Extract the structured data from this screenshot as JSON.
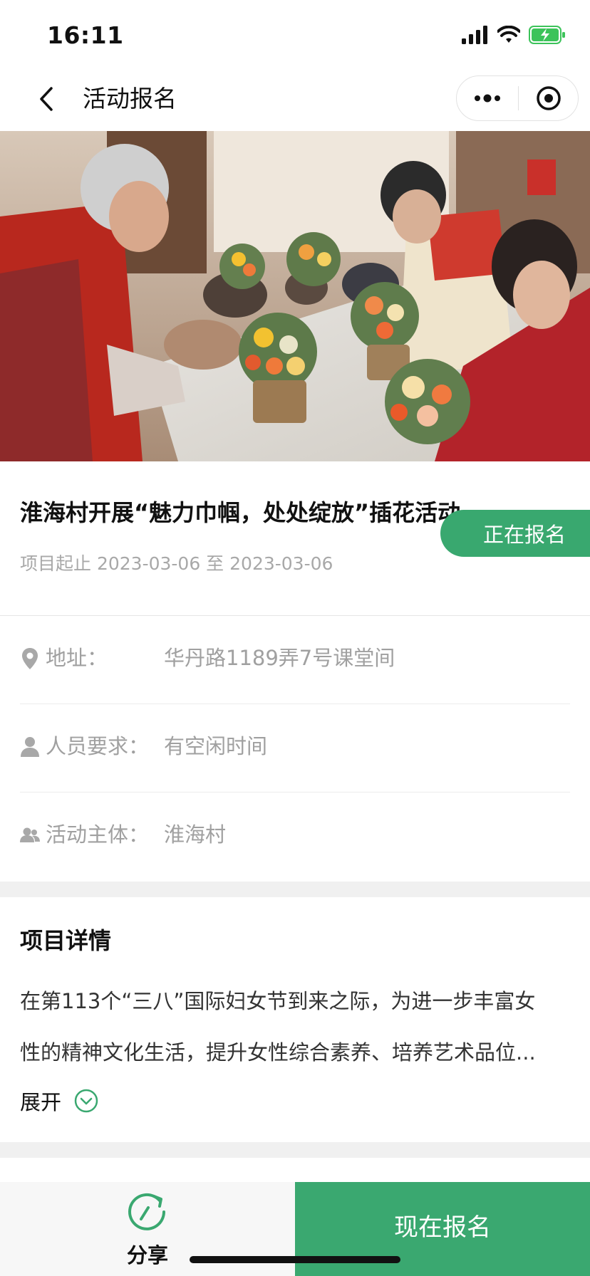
{
  "status_bar": {
    "time": "16:11"
  },
  "nav": {
    "title": "活动报名"
  },
  "banner": {
    "image": "flower-arranging-activity-photo"
  },
  "activity": {
    "title": "淮海村开展“魅力巾帼，处处绽放”插花活动",
    "dates": "项目起止 2023-03-06 至 2023-03-06",
    "status": "正在报名"
  },
  "info": {
    "address_label": "地址：",
    "address_value": "华丹路1189弄7号课堂间",
    "requirement_label": "人员要求：",
    "requirement_value": "有空闲时间",
    "organizer_label": "活动主体：",
    "organizer_value": "淮海村"
  },
  "details": {
    "heading": "项目详情",
    "line1": "在第113个“三八”国际妇女节到来之际，为进一步丰富女",
    "line2": "性的精神文化生活，提升女性综合素养、培养艺术品位...",
    "expand_label": "展开"
  },
  "bottom": {
    "share_label": "分享",
    "register_label": "现在报名"
  },
  "colors": {
    "accent": "#3aa870",
    "muted_text": "#a0a0a0",
    "battery": "#3cc35a"
  }
}
